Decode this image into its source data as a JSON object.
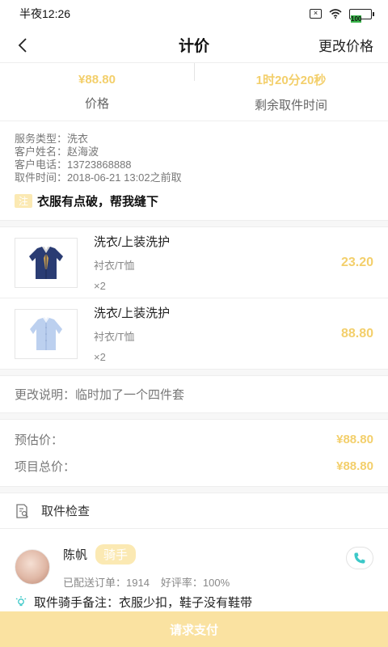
{
  "status_bar": {
    "time": "半夜12:26",
    "battery": "100",
    "icons": [
      "sim-off-icon",
      "wifi-icon",
      "battery-icon"
    ]
  },
  "nav": {
    "title": "计价",
    "action": "更改价格",
    "back_icon": "chevron-left-icon"
  },
  "summary": {
    "price_value": "¥88.80",
    "price_label": "价格",
    "time_value": "1时20分20秒",
    "time_label": "剩余取件时间"
  },
  "order": {
    "service_type": "服务类型：洗衣",
    "customer_name": "客户姓名：赵海波",
    "customer_phone": "客户电话：13723868888",
    "pickup_time": "取件时间：2018-06-21 13:02之前取",
    "note_tag": "注",
    "note_text": "衣服有点破，帮我缝下"
  },
  "items": [
    {
      "name": "洗衣/上装洗护",
      "type": "衬衣/T恤",
      "qty": "×2",
      "price": "23.20",
      "image": "navy-shirt-image"
    },
    {
      "name": "洗衣/上装洗护",
      "type": "衬衣/T恤",
      "qty": "×2",
      "price": "88.80",
      "image": "light-blue-shirt-image"
    }
  ],
  "change_note": "更改说明：临时加了一个四件套",
  "prices": {
    "estimated_label": "预估价：",
    "estimated_value": "¥88.80",
    "total_label": "项目总价：",
    "total_value": "¥88.80"
  },
  "inspection": {
    "label": "取件检查",
    "icon": "document-search-icon"
  },
  "rider": {
    "name": "陈帆",
    "badge": "骑手",
    "orders": "已配送订单：1914",
    "rating": "好评率：100%",
    "call_icon": "phone-icon"
  },
  "remark": {
    "text": "取件骑手备注：衣服少扣，鞋子没有鞋带",
    "icon": "bulb-icon"
  },
  "footer": {
    "pay_label": "请求支付"
  },
  "colors": {
    "accent": "#f3cf6b",
    "button": "#fae2a1",
    "call": "#3cc8c8"
  }
}
